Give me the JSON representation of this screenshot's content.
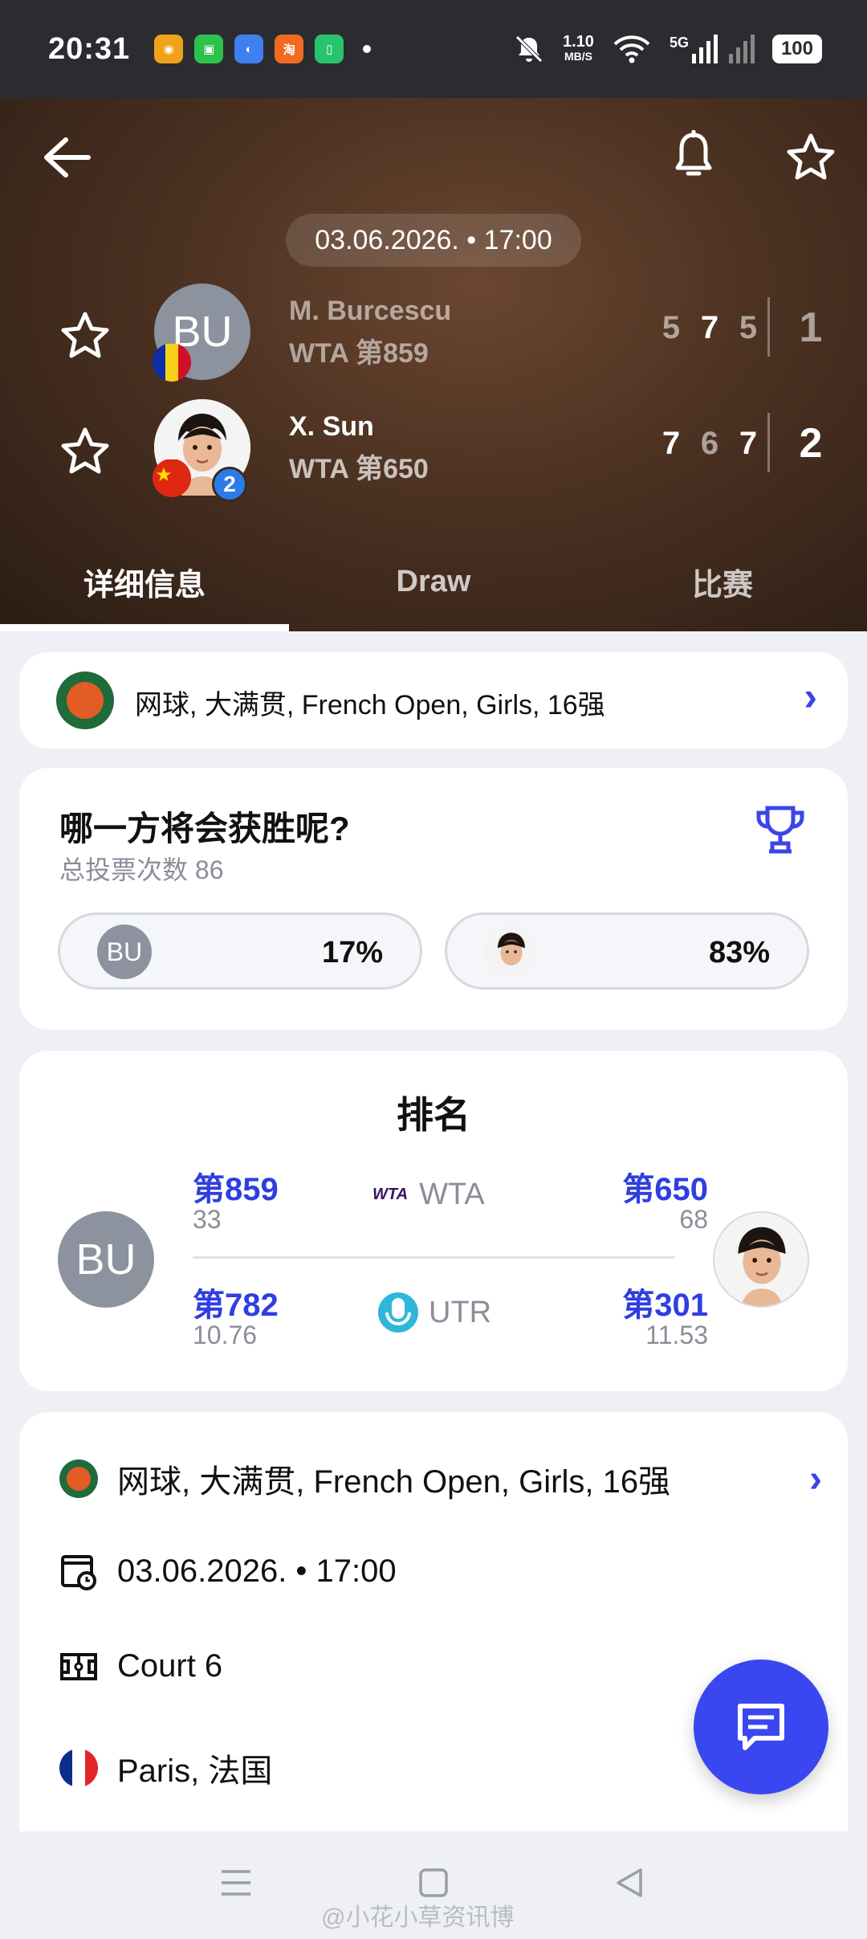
{
  "status_bar": {
    "time": "20:31",
    "net_speed_value": "1.10",
    "net_speed_unit": "MB/S",
    "signal_label": "5G",
    "battery": "100",
    "app_icons": [
      "weibo-icon",
      "wechat-icon",
      "browser-icon",
      "taobao-icon",
      "phone-manager-icon"
    ]
  },
  "header": {
    "date_time": "03.06.2026. • 17:00",
    "player1": {
      "initials": "BU",
      "name": "M. Burcescu",
      "rank": "WTA 第859",
      "sets": [
        "5",
        "7",
        "5"
      ],
      "total": "1",
      "flag": "Romania"
    },
    "player2": {
      "name": "X. Sun",
      "rank": "WTA 第650",
      "sets": [
        "7",
        "6",
        "7"
      ],
      "total": "2",
      "seed": "2",
      "flag": "China"
    },
    "tabs": [
      "详细信息",
      "Draw",
      "比赛"
    ]
  },
  "tournament_breadcrumb": "网球, 大满贯, French Open, Girls, 16强",
  "vote": {
    "title": "哪一方将会获胜呢?",
    "total_votes": "总投票次数 86",
    "player1_initials": "BU",
    "player1_pct": "17%",
    "player2_pct": "83%"
  },
  "ranking": {
    "title": "排名",
    "player1_initials": "BU",
    "wta": {
      "label": "WTA",
      "logo_text": "WTA",
      "p1_rank": "第859",
      "p1_points": "33",
      "p2_rank": "第650",
      "p2_points": "68"
    },
    "utr": {
      "label": "UTR",
      "p1_rank": "第782",
      "p1_points": "10.76",
      "p2_rank": "第301",
      "p2_points": "11.53"
    }
  },
  "info": {
    "tournament": "网球, 大满贯, French Open, Girls, 16强",
    "date_time": "03.06.2026. • 17:00",
    "court": "Court 6",
    "location": "Paris, 法国"
  },
  "watermark": "@小花小草资讯博",
  "colors": {
    "accent": "#3a47f0",
    "rank_blue": "#2f3ee0",
    "header_brown": "#4b3121"
  }
}
